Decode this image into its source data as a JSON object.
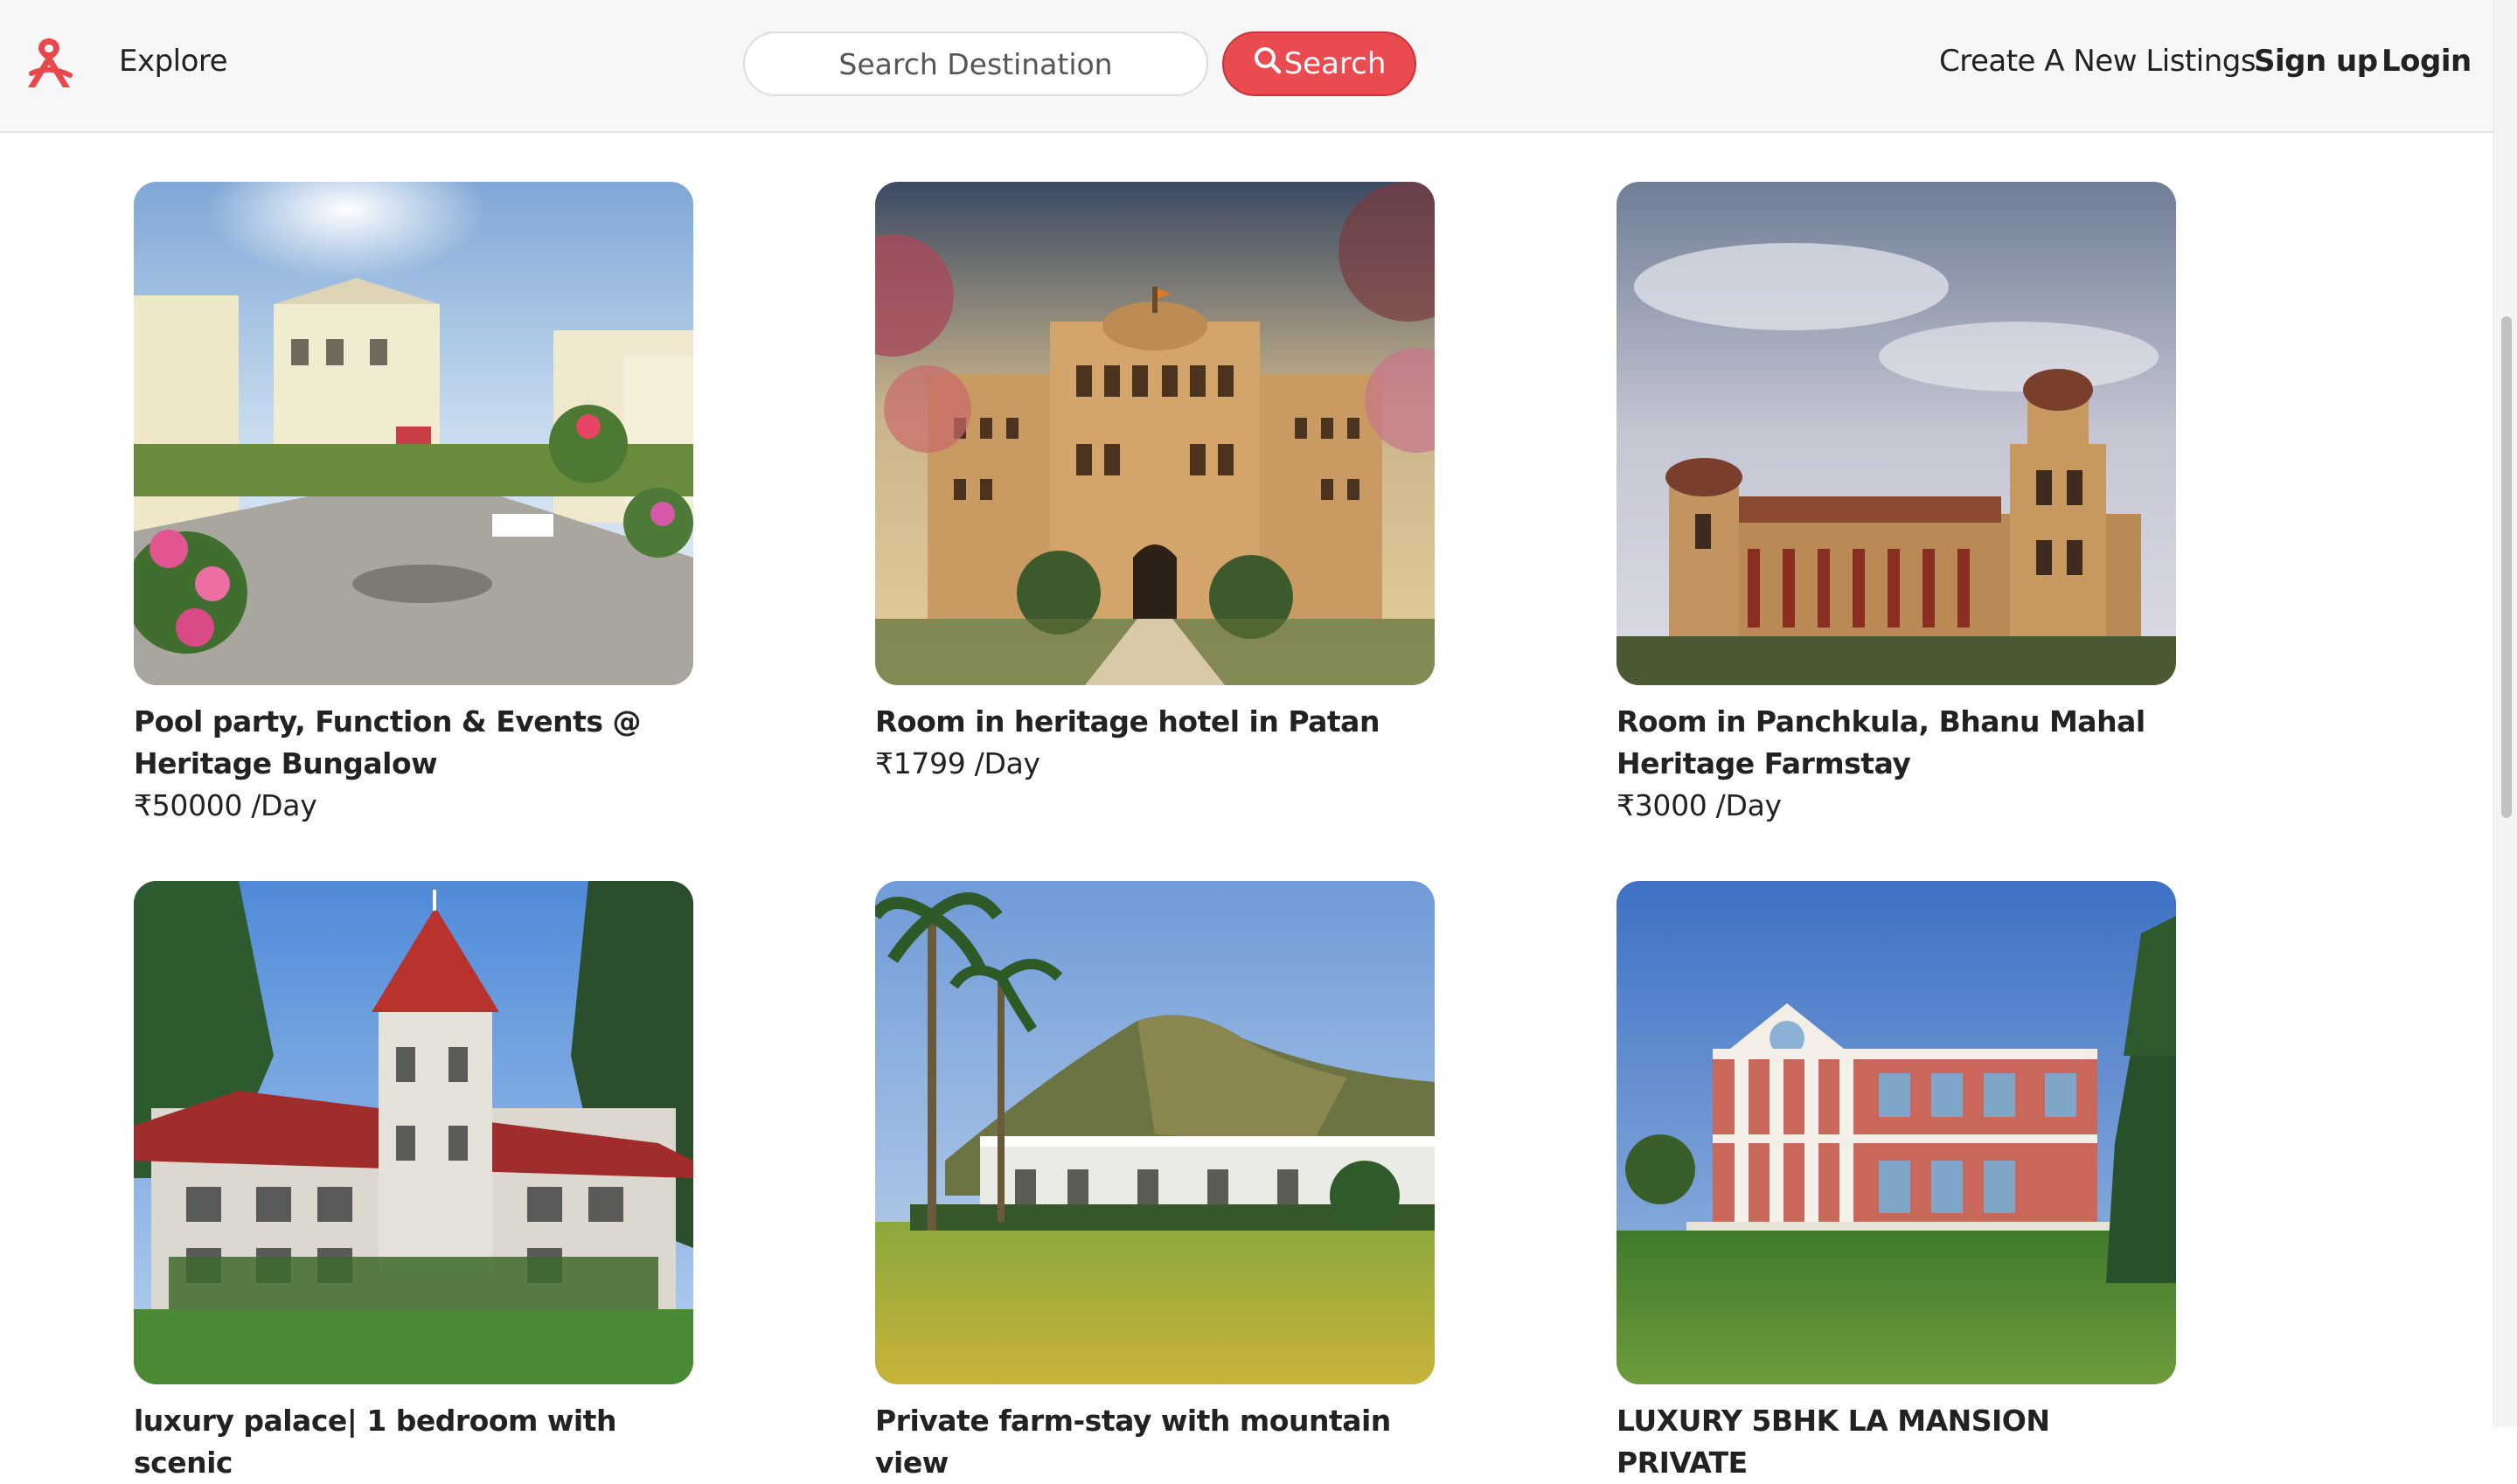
{
  "navbar": {
    "explore_label": "Explore",
    "search_placeholder": "Search Destination",
    "search_button_label": "Search",
    "create_listing_label": "Create A New Listings",
    "signup_label": "Sign up",
    "login_label": "Login",
    "brand_color": "#ea4b50"
  },
  "listings": [
    {
      "title": "Pool party, Function & Events @ Heritage Bungalow",
      "price": "₹50000 /Day"
    },
    {
      "title": "Room in heritage hotel in Patan",
      "price": "₹1799 /Day"
    },
    {
      "title": "Room in Panchkula, Bhanu Mahal Heritage Farmstay",
      "price": "₹3000 /Day"
    },
    {
      "title": "luxury palace| 1 bedroom with scenic",
      "price": ""
    },
    {
      "title": "Private farm-stay with mountain view",
      "price": ""
    },
    {
      "title": "LUXURY 5BHK LA MANSION PRIVATE",
      "price": ""
    }
  ]
}
